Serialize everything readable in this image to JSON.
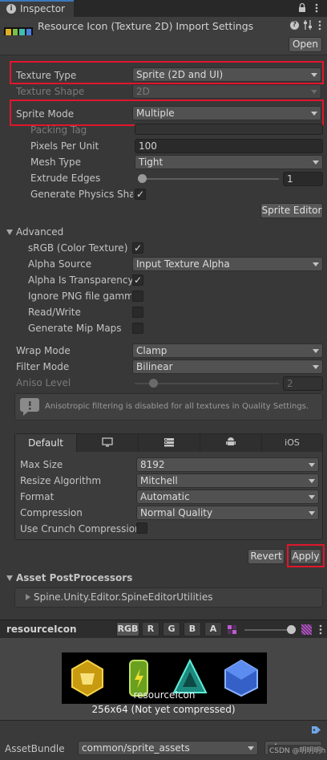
{
  "window": {
    "tab_label": "Inspector",
    "lock_icon": "lock-icon",
    "menu_icon": "kebab-menu-icon"
  },
  "header": {
    "title": "Resource Icon (Texture 2D) Import Settings",
    "open_label": "Open"
  },
  "texture": {
    "texture_type_label": "Texture Type",
    "texture_type_value": "Sprite (2D and UI)",
    "texture_shape_label": "Texture Shape",
    "texture_shape_value": "2D",
    "sprite_mode_label": "Sprite Mode",
    "sprite_mode_value": "Multiple",
    "packing_tag_label": "Packing Tag",
    "packing_tag_value": "",
    "ppu_label": "Pixels Per Unit",
    "ppu_value": "100",
    "mesh_type_label": "Mesh Type",
    "mesh_type_value": "Tight",
    "extrude_label": "Extrude Edges",
    "extrude_value": "1",
    "physics_label": "Generate Physics Shap",
    "sprite_editor_label": "Sprite Editor"
  },
  "advanced": {
    "title": "Advanced",
    "srgb_label": "sRGB (Color Texture)",
    "alpha_source_label": "Alpha Source",
    "alpha_source_value": "Input Texture Alpha",
    "alpha_transparency_label": "Alpha Is Transparency",
    "ignore_png_label": "Ignore PNG file gamma",
    "read_write_label": "Read/Write",
    "mipmaps_label": "Generate Mip Maps"
  },
  "wrap": {
    "wrap_mode_label": "Wrap Mode",
    "wrap_mode_value": "Clamp",
    "filter_mode_label": "Filter Mode",
    "filter_mode_value": "Bilinear",
    "aniso_label": "Aniso Level",
    "aniso_value": "2",
    "warning_text": "Anisotropic filtering is disabled for all textures in Quality Settings."
  },
  "platform": {
    "tabs": [
      "Default",
      "",
      "",
      "",
      "iOS"
    ],
    "tab_icons": [
      "",
      "monitor-icon",
      "server-icon",
      "android-icon",
      ""
    ],
    "max_size_label": "Max Size",
    "max_size_value": "8192",
    "resize_label": "Resize Algorithm",
    "resize_value": "Mitchell",
    "format_label": "Format",
    "format_value": "Automatic",
    "compression_label": "Compression",
    "compression_value": "Normal Quality",
    "crunch_label": "Use Crunch Compression"
  },
  "actions": {
    "revert_label": "Revert",
    "apply_label": "Apply"
  },
  "postprocessors": {
    "title": "Asset PostProcessors",
    "item": "Spine.Unity.Editor.SpineEditorUtilities"
  },
  "preview": {
    "name": "resourceIcon",
    "channels": [
      "RGB",
      "R",
      "G",
      "B",
      "A"
    ],
    "caption_name": "resourceIcon",
    "caption_info": "256x64 (Not yet compressed)"
  },
  "footer": {
    "assetbundle_label": "AssetBundle",
    "assetbundle_value": "common/sprite_assets",
    "variant_value": "ab",
    "watermark": "CSDN @明明明h"
  },
  "colors": {
    "highlight_red": "#e0162b",
    "accent_blue": "#3a79bb"
  }
}
